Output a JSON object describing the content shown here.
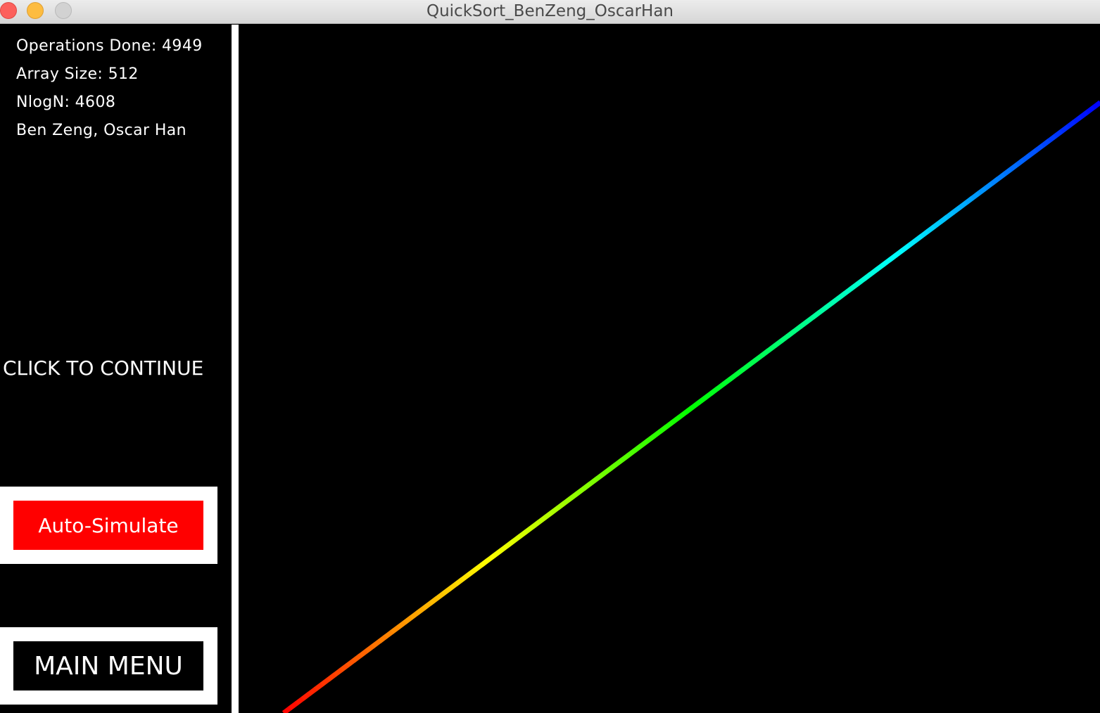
{
  "window": {
    "title": "QuickSort_BenZeng_OscarHan"
  },
  "stats": {
    "operations_done": "Operations Done: 4949",
    "array_size": "Array Size: 512",
    "nlogn": "NlogN: 4608",
    "authors": "Ben Zeng, Oscar Han"
  },
  "prompt": {
    "continue_label": "CLICK TO CONTINUE"
  },
  "buttons": {
    "auto_simulate_label": "Auto-Simulate",
    "main_menu_label": "MAIN MENU"
  },
  "colors": {
    "auto_simulate_bg": "#ff0000",
    "main_menu_bg": "#000000",
    "frame": "#ffffff",
    "background": "#000000"
  },
  "visualization": {
    "array_size": 512,
    "state": "sorted",
    "color_scheme": "rainbow-hue",
    "hue_start_deg": 0,
    "hue_end_deg": 240
  }
}
